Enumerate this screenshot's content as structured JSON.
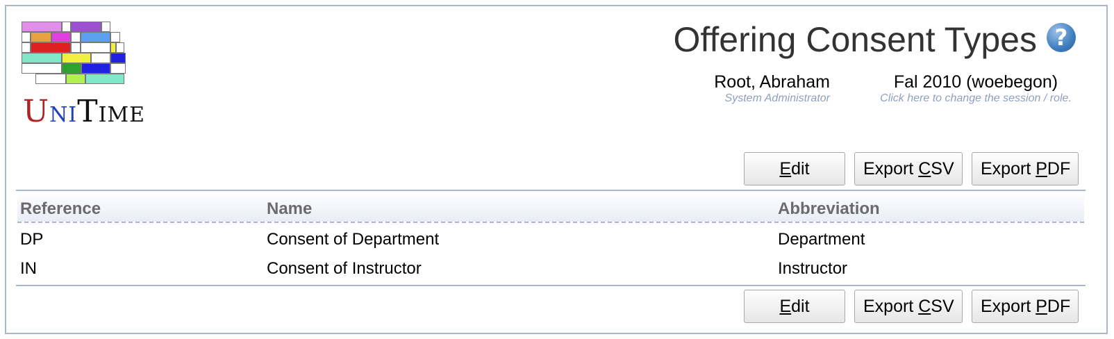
{
  "logo": {
    "text_u": "U",
    "text_ni": "NI",
    "text_t": "T",
    "text_ime": "IME"
  },
  "header": {
    "title": "Offering Consent Types",
    "help_glyph": "?",
    "user_name": "Root, Abraham",
    "user_role": "System Administrator",
    "session_name": "Fal 2010 (woebegon)",
    "session_hint": "Click here to change the session / role."
  },
  "buttons": {
    "edit_pre": "",
    "edit_key": "E",
    "edit_post": "dit",
    "csv_pre": "Export ",
    "csv_key": "C",
    "csv_post": "SV",
    "pdf_pre": "Export ",
    "pdf_key": "P",
    "pdf_post": "DF"
  },
  "table": {
    "headers": [
      "Reference",
      "Name",
      "Abbreviation"
    ],
    "rows": [
      [
        "DP",
        "Consent of Department",
        "Department"
      ],
      [
        "IN",
        "Consent of Instructor",
        "Instructor"
      ]
    ]
  },
  "colors": {
    "border": "#aab6cc",
    "hint": "#8ea0bf",
    "logo_u": "#b22222",
    "logo_ni": "#2040c0",
    "logo_t": "#111111"
  }
}
